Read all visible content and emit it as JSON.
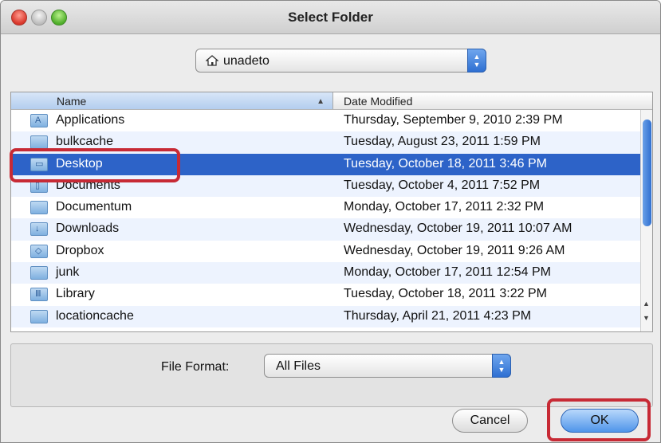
{
  "window": {
    "title": "Select Folder"
  },
  "path_popup": {
    "label": "unadeto",
    "icon": "home-icon"
  },
  "browser": {
    "columns": {
      "name": "Name",
      "date": "Date Modified"
    },
    "rows": [
      {
        "name": "Applications",
        "date": "Thursday, September 9, 2010 2:39 PM",
        "icon": "applications-folder-icon"
      },
      {
        "name": "bulkcache",
        "date": "Tuesday, August 23, 2011 1:59 PM",
        "icon": "folder-icon"
      },
      {
        "name": "Desktop",
        "date": "Tuesday, October 18, 2011 3:46 PM",
        "icon": "desktop-folder-icon"
      },
      {
        "name": "Documents",
        "date": "Tuesday, October 4, 2011 7:52 PM",
        "icon": "documents-folder-icon"
      },
      {
        "name": "Documentum",
        "date": "Monday, October 17, 2011 2:32 PM",
        "icon": "folder-icon"
      },
      {
        "name": "Downloads",
        "date": "Wednesday, October 19, 2011 10:07 AM",
        "icon": "downloads-folder-icon"
      },
      {
        "name": "Dropbox",
        "date": "Wednesday, October 19, 2011 9:26 AM",
        "icon": "dropbox-folder-icon"
      },
      {
        "name": "junk",
        "date": "Monday, October 17, 2011 12:54 PM",
        "icon": "folder-icon"
      },
      {
        "name": "Library",
        "date": "Tuesday, October 18, 2011 3:22 PM",
        "icon": "library-folder-icon"
      },
      {
        "name": "locationcache",
        "date": "Thursday, April 21, 2011 4:23 PM",
        "icon": "folder-icon"
      }
    ]
  },
  "format": {
    "label": "File Format:",
    "value": "All Files"
  },
  "buttons": {
    "cancel": "Cancel",
    "ok": "OK"
  },
  "colors": {
    "selection": "#2d63c8",
    "highlight": "#c72a35",
    "accent": "#4f95ea"
  }
}
